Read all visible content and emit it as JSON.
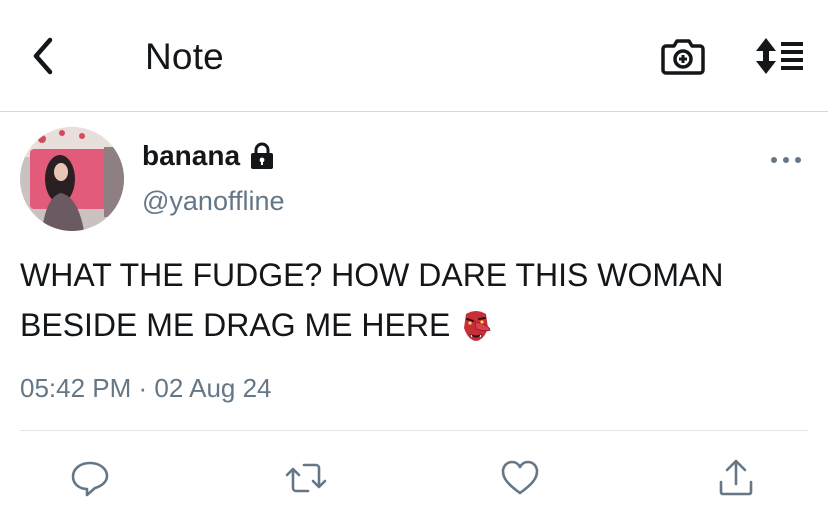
{
  "header": {
    "title": "Note",
    "back_icon": "chevron-left-icon",
    "camera_icon": "camera-icon",
    "sort_icon": "sort-icon"
  },
  "tweet": {
    "display_name": "banana",
    "handle": "@yanoffline",
    "protected_icon": "lock-icon",
    "more_icon": "more-horizontal-icon",
    "text_line1": "WHAT THE FUDGE? HOW DARE THIS WOMAN",
    "text_line2": "BESIDE ME DRAG ME HERE",
    "emoji": "tengu-mask-emoji",
    "timestamp": "05:42 PM · 02 Aug 24"
  },
  "actions": [
    {
      "name": "reply",
      "icon": "reply-icon"
    },
    {
      "name": "retweet",
      "icon": "retweet-icon"
    },
    {
      "name": "like",
      "icon": "heart-icon"
    },
    {
      "name": "share",
      "icon": "share-icon"
    }
  ],
  "colors": {
    "text": "#14171a",
    "secondary": "#657786",
    "divider": "#e1e8ed",
    "icon": "#657786"
  }
}
